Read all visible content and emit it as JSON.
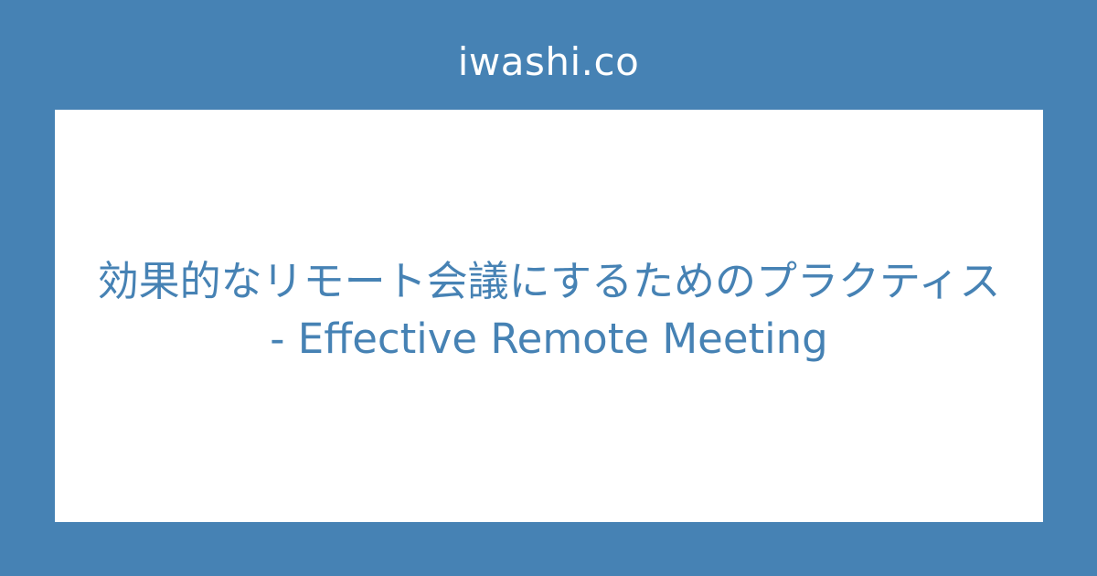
{
  "site": {
    "name": "iwashi.co"
  },
  "article": {
    "title": "効果的なリモート会議にするためのプラクティス - Effective Remote Meeting"
  },
  "colors": {
    "background": "#4682b4",
    "card": "#ffffff",
    "title_text": "#4682b4",
    "site_text": "#ffffff"
  }
}
